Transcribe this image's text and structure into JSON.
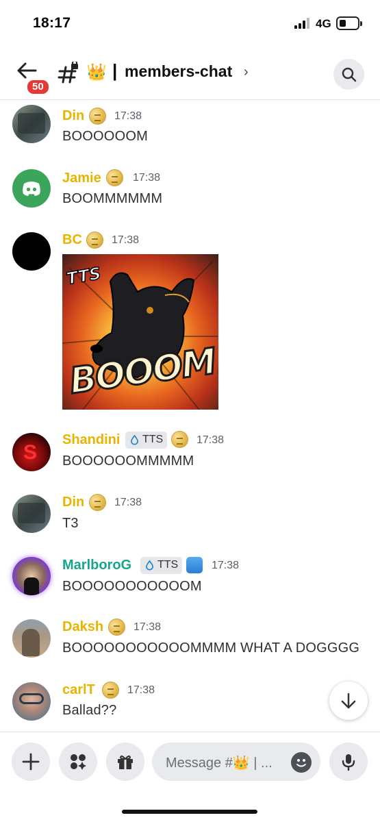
{
  "status_bar": {
    "time": "18:17",
    "network": "4G"
  },
  "header": {
    "unread_badge": "50",
    "channel_emoji": "👑",
    "separator": "|",
    "channel_name": "members-chat",
    "chevron": "›",
    "icons": {
      "back": "back-arrow-icon",
      "channel": "hash-lock-icon",
      "search": "search-icon"
    }
  },
  "messages": [
    {
      "username": "Din",
      "time": "17:38",
      "text": "BOOOOOOM",
      "name_color": "#e8b400"
    },
    {
      "username": "Jamie",
      "time": "17:38",
      "text": "BOOMMMMMM",
      "name_color": "#e8b400"
    },
    {
      "username": "BC",
      "time": "17:38",
      "image_text_top": "TTS",
      "image_text_main": "BOOOM!",
      "name_color": "#e8b400"
    },
    {
      "username": "Shandini",
      "tag": "TTS",
      "time": "17:38",
      "text": "BOOOOOOMMMMM",
      "name_color": "#e8b400"
    },
    {
      "username": "Din",
      "time": "17:38",
      "text": "T3",
      "name_color": "#e8b400"
    },
    {
      "username": "MarlboroG",
      "tag": "TTS",
      "time": "17:38",
      "text": "BOOOOOOOOOOOM",
      "name_color": "#19a58c"
    },
    {
      "username": "Daksh",
      "time": "17:38",
      "text": "BOOOOOOOOOOOMMMM WHAT A DOGGGG",
      "name_color": "#e8b400"
    },
    {
      "username": "carlT",
      "time": "17:38",
      "text": "Ballad??",
      "name_color": "#e8b400"
    }
  ],
  "composer": {
    "placeholder": "Message #👑 | ...",
    "icons": [
      "plus-icon",
      "apps-icon",
      "gift-icon",
      "emoji-icon",
      "microphone-icon"
    ]
  },
  "colors": {
    "gold_name": "#e8b400",
    "teal_name": "#19a58c",
    "badge_red": "#e53935"
  }
}
